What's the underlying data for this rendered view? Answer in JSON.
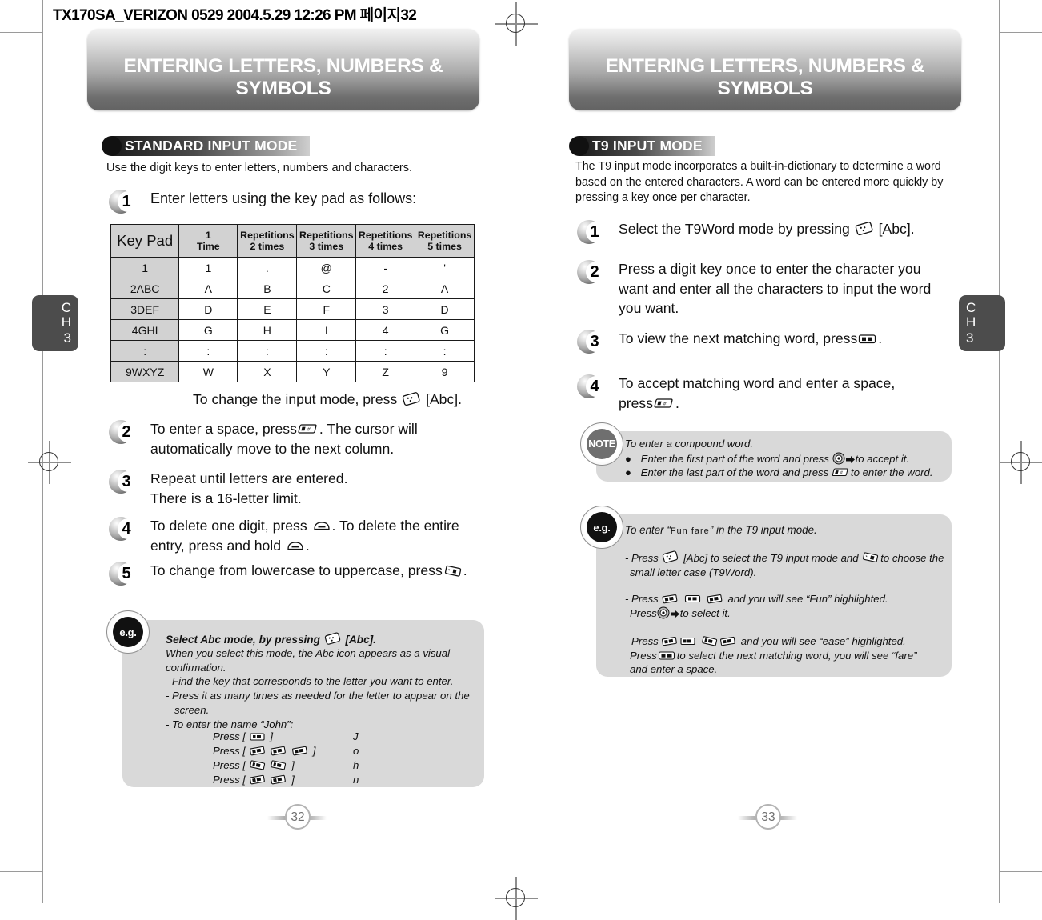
{
  "print_header": "TX170SA_VERIZON 0529  2004.5.29 12:26 PM  페이지32",
  "left_page": {
    "banner_title": "ENTERING LETTERS, NUMBERS & SYMBOLS",
    "section_title": "STANDARD INPUT MODE",
    "intro": "Use the digit keys to enter letters, numbers and characters.",
    "steps": [
      {
        "num": "1",
        "text": "Enter letters using the key pad as follows:"
      },
      {
        "num": "",
        "text": "To change the input mode, press  [Abc]."
      },
      {
        "num": "2",
        "text": "To enter a space, press . The cursor will automatically move to the next column."
      },
      {
        "num": "3",
        "text": "Repeat until letters are entered.\nThere is a 16-letter limit."
      },
      {
        "num": "4",
        "text": "To delete one digit, press . To delete the entire entry, press and hold ."
      },
      {
        "num": "5",
        "text": "To change from lowercase to uppercase, press ."
      }
    ],
    "table": {
      "headers": [
        "Key Pad",
        "1\nTime",
        "Repetitions\n2 times",
        "Repetitions\n3 times",
        "Repetitions\n4 times",
        "Repetitions\n5 times"
      ],
      "header_cells": [
        {
          "line1": "Key Pad",
          "line2": ""
        },
        {
          "line1": "1",
          "line2": "Time"
        },
        {
          "line1": "Repetitions",
          "line2": "2 times"
        },
        {
          "line1": "Repetitions",
          "line2": "3 times"
        },
        {
          "line1": "Repetitions",
          "line2": "4 times"
        },
        {
          "line1": "Repetitions",
          "line2": "5 times"
        }
      ],
      "rows": [
        [
          "1",
          "1",
          ".",
          "@",
          "-",
          "'"
        ],
        [
          "2ABC",
          "A",
          "B",
          "C",
          "2",
          "A"
        ],
        [
          "3DEF",
          "D",
          "E",
          "F",
          "3",
          "D"
        ],
        [
          "4GHI",
          "G",
          "H",
          "I",
          "4",
          "G"
        ],
        [
          ":",
          ":",
          ":",
          ":",
          ":",
          ":"
        ],
        [
          "9WXYZ",
          "W",
          "X",
          "Y",
          "Z",
          "9"
        ]
      ]
    },
    "eg_box": {
      "badge": "e.g.",
      "heading_pre": "Select Abc mode, by pressing",
      "heading_post": "[Abc].",
      "lines": [
        "When you select this mode, the Abc icon appears as a visual",
        "confirmation.",
        "- Find the key that corresponds to the letter you want to enter.",
        "- Press it as many times as needed for the letter to appear on the",
        "   screen.",
        "- To enter the name “John”:"
      ],
      "john_rows": [
        {
          "press": "Press [",
          "close": "]",
          "keys": 1,
          "keytype": "five",
          "result": "J"
        },
        {
          "press": "Press [",
          "close": "]",
          "keys": 3,
          "keytype": "six",
          "result": "o"
        },
        {
          "press": "Press [",
          "close": "]",
          "keys": 2,
          "keytype": "four",
          "result": "h"
        },
        {
          "press": "Press [",
          "close": "]",
          "keys": 2,
          "keytype": "six",
          "result": "n"
        }
      ]
    },
    "chapter_tab": {
      "c": "C",
      "h": "H",
      "n": "3"
    },
    "page_number": "32"
  },
  "right_page": {
    "banner_title": "ENTERING LETTERS, NUMBERS & SYMBOLS",
    "section_title": "T9 INPUT MODE",
    "intro": "The T9 input mode incorporates a built-in-dictionary to determine a word based on the entered characters. A word can be entered more quickly by pressing a key once per character.",
    "steps": [
      {
        "num": "1",
        "text": "Select the T9Word mode by pressing  [Abc]."
      },
      {
        "num": "2",
        "text": "Press a digit key once to enter the character you want and enter all the characters to input the word you want."
      },
      {
        "num": "3",
        "text": "To view the next matching word, press ."
      },
      {
        "num": "4",
        "text": "To accept matching word and enter a space, press ."
      }
    ],
    "note_box": {
      "badge": "NOTE",
      "title": "To enter a compound word.",
      "bullets": [
        "Enter the first part of the word and press  to accept it.",
        "Enter the last part of the word and press  to enter the word."
      ]
    },
    "eg_box": {
      "badge": "e.g.",
      "title_pre": "To enter “",
      "title_word": "Fun fare",
      "title_post": "” in the T9 input mode.",
      "para1_a": "- Press",
      "para1_b": "[Abc] to select the T9 input mode and",
      "para1_c": "to choose the",
      "para1_d": "small letter case (T9Word).",
      "para2_a": "- Press",
      "para2_b": "and you will see “Fun” highlighted.",
      "para2_c": "Press",
      "para2_d": "to select it.",
      "para3_a": "- Press",
      "para3_b": "and you will see “ease” highlighted.",
      "para3_c": "Press",
      "para3_d": "to select the next matching word, you will see “fare”",
      "para3_e": "and enter a space."
    },
    "chapter_tab": {
      "c": "C",
      "h": "H",
      "n": "3"
    },
    "page_number": "33"
  }
}
